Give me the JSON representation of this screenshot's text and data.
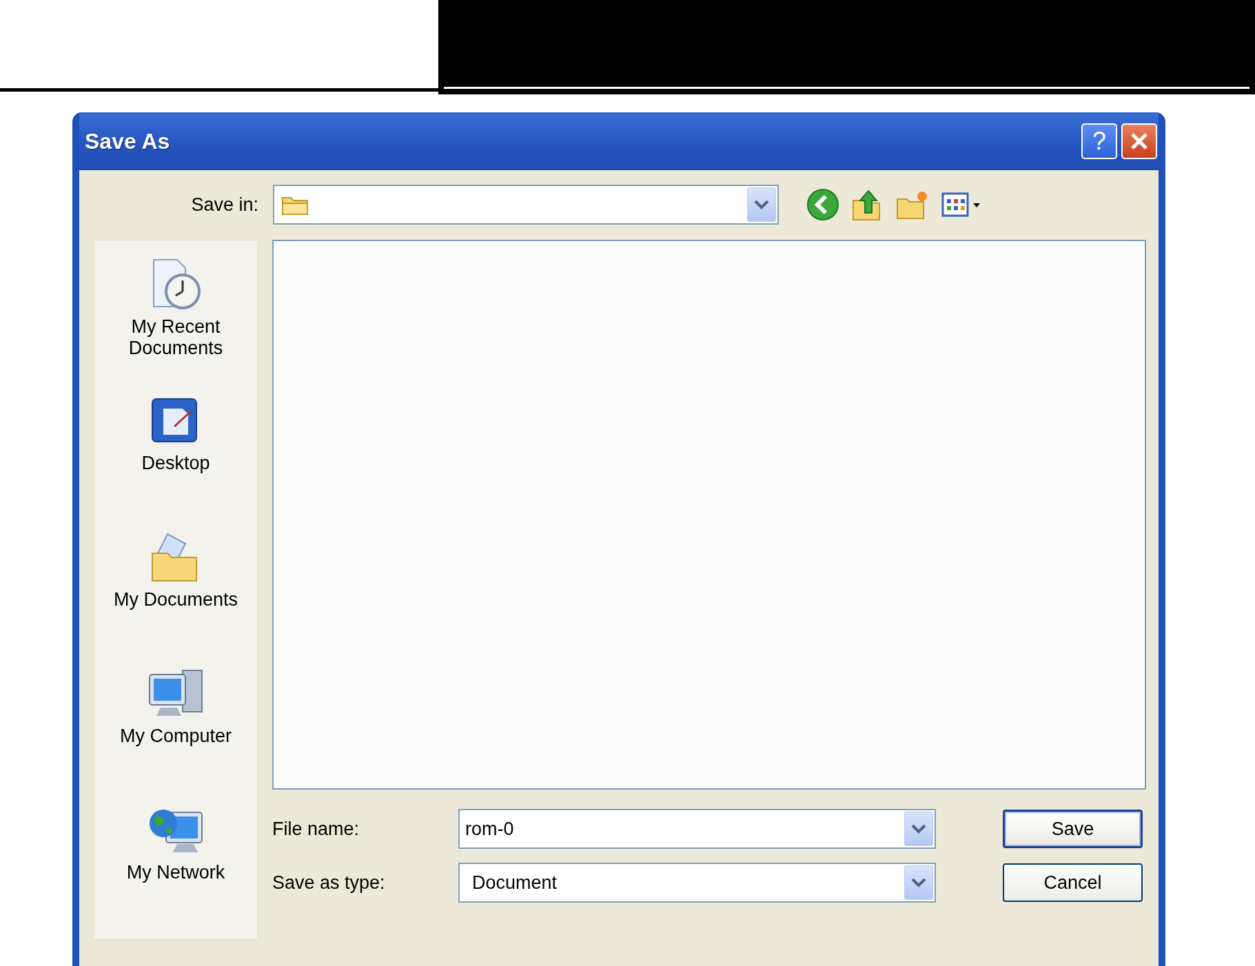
{
  "window": {
    "title": "Save As",
    "help_button": "?"
  },
  "save_in": {
    "label": "Save in:"
  },
  "places": [
    {
      "kind": "recent",
      "label": "My Recent Documents"
    },
    {
      "kind": "desktop",
      "label": "Desktop"
    },
    {
      "kind": "documents",
      "label": "My Documents"
    },
    {
      "kind": "computer",
      "label": "My Computer"
    },
    {
      "kind": "network",
      "label": "My Network"
    }
  ],
  "file_name": {
    "label": "File name:",
    "value": "rom-0"
  },
  "save_as_type": {
    "label": "Save as type:",
    "value": "Document"
  },
  "buttons": [
    {
      "label": "Save",
      "default": true
    },
    {
      "label": "Cancel",
      "default": false
    }
  ]
}
